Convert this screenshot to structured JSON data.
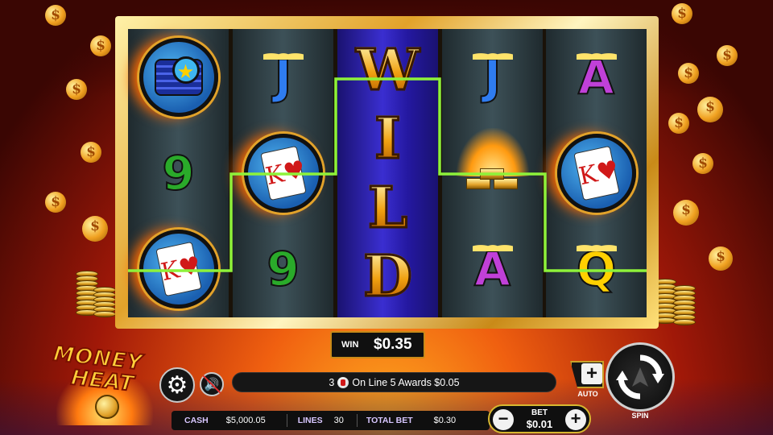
{
  "game": {
    "logo_line1": "MONEY",
    "logo_line2": "HEAT"
  },
  "reels": [
    [
      "chips-star",
      "9",
      "card-king-hearts"
    ],
    [
      "J",
      "card-king-hearts",
      "9"
    ],
    [
      "WILD"
    ],
    [
      "J",
      "gold-bars-fire",
      "A"
    ],
    [
      "A",
      "card-king-hearts",
      "Q"
    ]
  ],
  "symbols": {
    "j": "J",
    "nine": "9",
    "a": "A",
    "q": "Q",
    "card_rank": "K",
    "wild": [
      "W",
      "I",
      "L",
      "D"
    ]
  },
  "win": {
    "label": "WIN",
    "value": "$0.35"
  },
  "message": {
    "prefix": "3",
    "text": "On Line 5 Awards $0.05"
  },
  "status": {
    "cash_label": "CASH",
    "cash_value": "$5,000.05",
    "lines_label": "LINES",
    "lines_value": "30",
    "total_bet_label": "TOTAL BET",
    "total_bet_value": "$0.30"
  },
  "bet": {
    "label": "BET",
    "value": "$0.01",
    "minus": "−",
    "plus": "+"
  },
  "controls": {
    "auto_label": "AUTO",
    "auto_plus": "+",
    "spin_label": "SPIN",
    "settings_icon": "⚙",
    "sound_icon": "🔊"
  },
  "decor": {
    "coin_glyph": "$"
  },
  "colors": {
    "payline": "#8ef23a",
    "frame_gold": "#e2a22a",
    "bet_border": "#d8b830"
  }
}
